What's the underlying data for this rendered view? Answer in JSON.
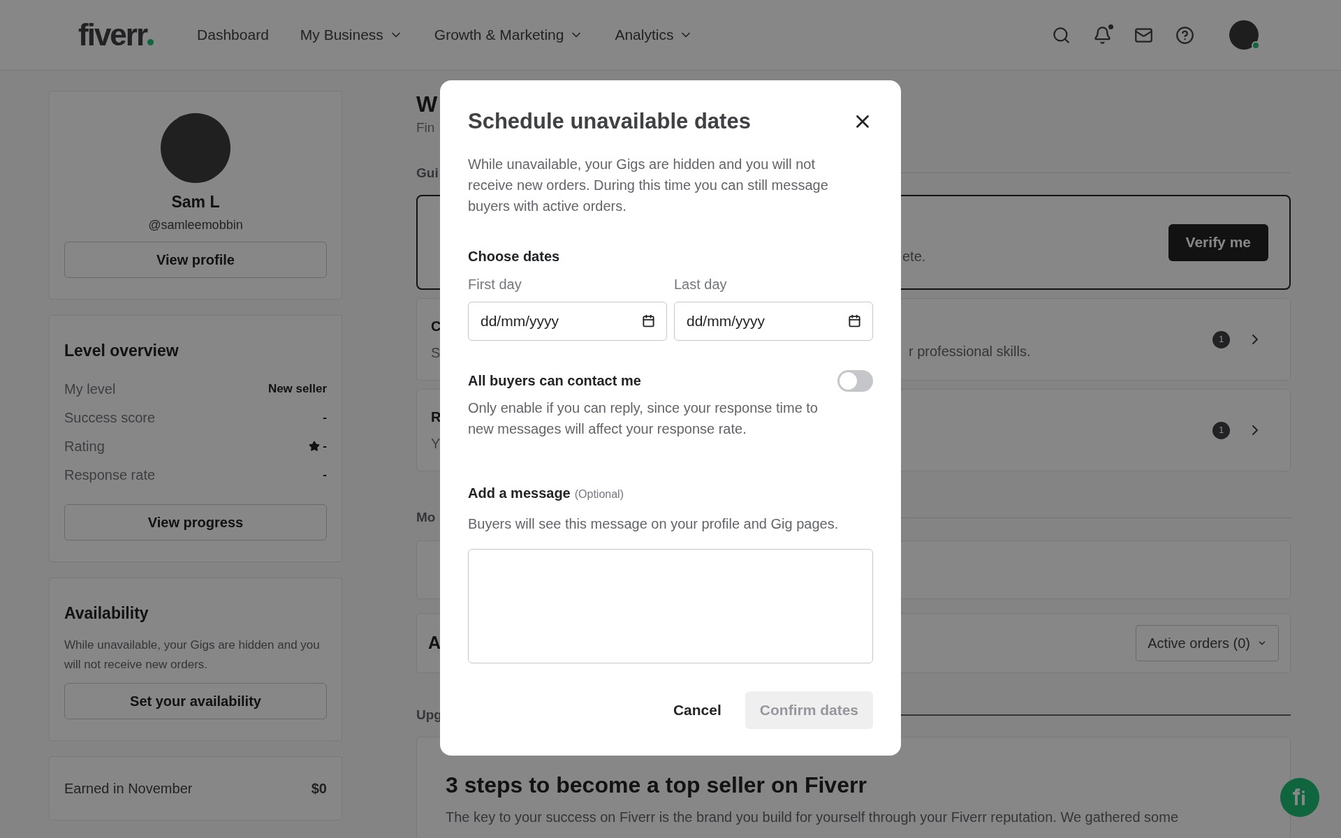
{
  "header": {
    "logo": "fiverr",
    "nav": [
      {
        "label": "Dashboard",
        "dropdown": false
      },
      {
        "label": "My Business",
        "dropdown": true
      },
      {
        "label": "Growth & Marketing",
        "dropdown": true
      },
      {
        "label": "Analytics",
        "dropdown": true
      }
    ],
    "notifications_unread": true,
    "avatar_online": true
  },
  "sidebar": {
    "profile": {
      "name": "Sam L",
      "handle": "@samleemobbin",
      "button": "View profile"
    },
    "level_overview": {
      "title": "Level overview",
      "rows": [
        {
          "label": "My level",
          "value": "New seller",
          "kind": "text"
        },
        {
          "label": "Success score",
          "value": "-",
          "kind": "text"
        },
        {
          "label": "Rating",
          "value": "-",
          "kind": "rating"
        },
        {
          "label": "Response rate",
          "value": "-",
          "kind": "text"
        }
      ],
      "button": "View progress"
    },
    "availability": {
      "title": "Availability",
      "text": "While unavailable, your Gigs are hidden and you will not receive new orders.",
      "button": "Set your availability"
    },
    "earnings": {
      "label": "Earned in November",
      "value": "$0"
    }
  },
  "main": {
    "title_fragment": "W",
    "subtitle_fragment": "Fin",
    "section_1": "Gui",
    "verify_card": {
      "text_fragment": "ete.",
      "button": "Verify me"
    },
    "cards": [
      {
        "title_fragment": "C",
        "text_fragment": "S",
        "trailing_text": "r professional skills.",
        "badge": "1"
      },
      {
        "title_fragment": "R",
        "text_fragment": "Y",
        "badge": "1"
      }
    ],
    "section_2": "Mo",
    "orders_card": {
      "title_fragment": "A",
      "dropdown": "Active orders (0)"
    },
    "section_3": "Upg",
    "steps": {
      "title": "3 steps to become a top seller on Fiverr",
      "text": "The key to your success on Fiverr is the brand you build for yourself through your Fiverr reputation. We gathered some"
    }
  },
  "modal": {
    "title": "Schedule unavailable dates",
    "description": "While unavailable, your Gigs are hidden and you will not receive new orders. During this time you can still message buyers with active orders.",
    "dates": {
      "heading": "Choose dates",
      "fields": [
        {
          "label": "First day",
          "placeholder": "dd/mm/yyyy"
        },
        {
          "label": "Last day",
          "placeholder": "dd/mm/yyyy"
        }
      ]
    },
    "contact": {
      "label": "All buyers can contact me",
      "on": false,
      "help": "Only enable if you can reply, since your response time to new messages will affect your response rate."
    },
    "message": {
      "label": "Add a message",
      "optional": "(Optional)",
      "help": "Buyers will see this message on your profile and Gig pages."
    },
    "cancel": "Cancel",
    "confirm": {
      "label": "Confirm dates",
      "disabled": true
    }
  }
}
